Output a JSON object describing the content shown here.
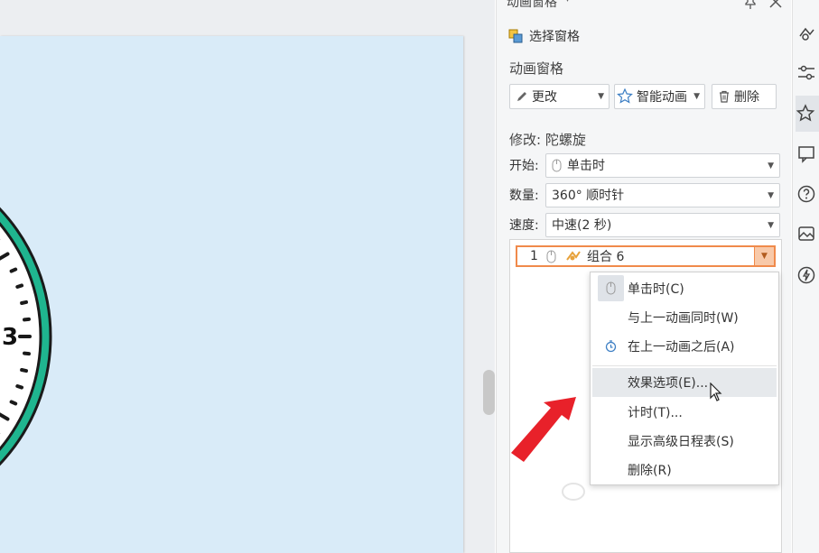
{
  "pane": {
    "title": "动画窗格",
    "select_pane_label": "选择窗格",
    "section_label": "动画窗格",
    "buttons": {
      "change": "更改",
      "smart_animation": "智能动画",
      "delete": "删除"
    },
    "modify_label": "修改: 陀螺旋",
    "properties": {
      "start_label": "开始:",
      "start_value": "单击时",
      "amount_label": "数量:",
      "amount_value": "360° 顺时针",
      "speed_label": "速度:",
      "speed_value": "中速(2 秒)"
    },
    "animation_item": {
      "index": "1",
      "name": "组合 6"
    }
  },
  "context_menu": {
    "items": [
      {
        "label": "单击时(C)",
        "icon": "mouse-icon",
        "checked": true
      },
      {
        "label": "与上一动画同时(W)",
        "icon": "",
        "checked": false
      },
      {
        "label": "在上一动画之后(A)",
        "icon": "clock-icon",
        "checked": false
      },
      {
        "label": "效果选项(E)...",
        "icon": "",
        "hovered": true
      },
      {
        "label": "计时(T)...",
        "icon": ""
      },
      {
        "label": "显示高级日程表(S)",
        "icon": ""
      },
      {
        "label": "删除(R)",
        "icon": ""
      }
    ]
  },
  "slide": {
    "clock_visible_numeral": "3",
    "background_color": "#d9ebf8",
    "clock_ring_color": "#1fb58f"
  },
  "colors": {
    "accent_orange": "#f08a4b",
    "annotation_arrow": "#e8212a"
  },
  "toolbar_icons": [
    "animation-icon",
    "settings-sliders-icon",
    "animation-star-icon",
    "feedback-icon",
    "help-icon",
    "image-icon",
    "lightning-icon"
  ]
}
